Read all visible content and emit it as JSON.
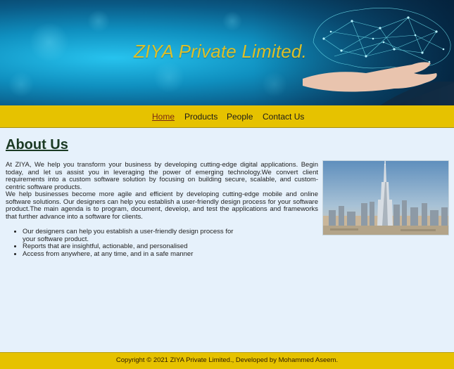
{
  "header": {
    "title": "ZIYA Private Limited."
  },
  "nav": {
    "items": [
      {
        "label": "Home",
        "active": true
      },
      {
        "label": "Products",
        "active": false
      },
      {
        "label": "People",
        "active": false
      },
      {
        "label": "Contact Us",
        "active": false
      }
    ]
  },
  "about": {
    "heading": "About Us",
    "paragraphs": [
      "At ZIYA, We help you transform your business by developing cutting-edge digital applications. Begin today, and let us assist you in leveraging the power of emerging technology.We convert client requirements into a custom software solution by focusing on building secure, scalable, and custom-centric software products.",
      "We help businesses become more agile and efficient by developing cutting-edge mobile and online software solutions. Our designers can help you establish a user-friendly design process for your software product.The main agenda is to program, document, develop, and test the applications and frameworks that further advance into a software for clients."
    ],
    "bullets": [
      "Our designers can help you establish a user-friendly design process for your software product.",
      "Reports that are insightful, actionable, and personalised",
      "Access from anywhere, at any time, and in a safe manner"
    ]
  },
  "footer": {
    "copyright": "Copyright © 2021 ZIYA Private Limited., Developed by Mohammed Aseem."
  },
  "colors": {
    "accent_yellow": "#e6c200",
    "title_gold": "#dcbf2a",
    "heading_green": "#1b3a24",
    "content_bg": "#e6f1fb"
  },
  "icons": {
    "hero_graphic": "network-brain-on-hand-image",
    "content_image": "city-skyline-image"
  }
}
